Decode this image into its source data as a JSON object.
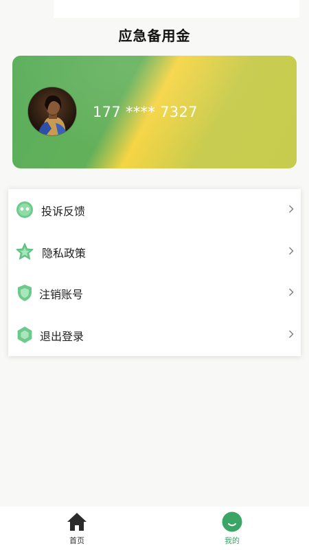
{
  "page": {
    "title": "应急备用金"
  },
  "profile": {
    "phone": "177 **** 7327",
    "avatar_icon": "user-avatar-photo"
  },
  "menu": {
    "items": [
      {
        "label": "投诉反馈",
        "icon": "chat-bubble-icon"
      },
      {
        "label": "隐私政策",
        "icon": "star-icon"
      },
      {
        "label": "注销账号",
        "icon": "shield-icon"
      },
      {
        "label": "退出登录",
        "icon": "hexagon-icon"
      }
    ],
    "chevron_icon": "chevron-right-icon"
  },
  "nav": {
    "home_label": "首页",
    "mine_label": "我的",
    "home_icon": "house-icon",
    "mine_icon": "smile-face-icon"
  },
  "colors": {
    "accent_green": "#3aa565",
    "icon_green": "#6ccb8a",
    "card_green": "#5aae5c",
    "card_yellow": "#f6d544"
  }
}
